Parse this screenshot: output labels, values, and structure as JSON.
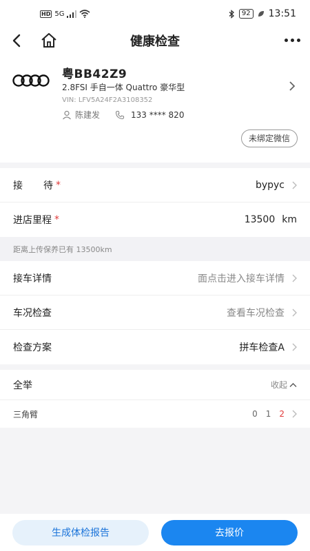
{
  "status_bar": {
    "hd": "HD",
    "signal": "5G",
    "battery": "92",
    "time": "13:51"
  },
  "navbar": {
    "title": "健康检查"
  },
  "vehicle": {
    "plate": "粤BB42Z9",
    "model": "2.8FSI 手自一体 Quattro 豪华型",
    "vin": "VIN: LFV5A24F2A3108352",
    "owner_name": "陈建发",
    "phone": "133 **** 820",
    "wechat_button": "未绑定微信"
  },
  "form": {
    "reception": {
      "label_a": "接",
      "label_b": "待",
      "value": "bypyc"
    },
    "mileage": {
      "label": "进店里程",
      "value": "13500",
      "unit": "km"
    },
    "info_note": "距离上传保养已有 13500km",
    "pickup_details": {
      "label": "接车详情",
      "value": "面点击进入接车详情"
    },
    "vehicle_check": {
      "label": "车况检查",
      "value": "查看车况检查"
    },
    "plan": {
      "label": "检查方案",
      "value": "拼车检查A"
    }
  },
  "check_group": {
    "title": "全举",
    "collapse_label": "收起",
    "items": [
      {
        "name": "三角臂",
        "counts": [
          "0",
          "1",
          "2"
        ]
      }
    ]
  },
  "actions": {
    "report_label": "生成体检报告",
    "quote_label": "去报价"
  },
  "colors": {
    "accent": "#1b86f0",
    "required": "#e03a3a",
    "report_bg": "#e6f1fb"
  }
}
